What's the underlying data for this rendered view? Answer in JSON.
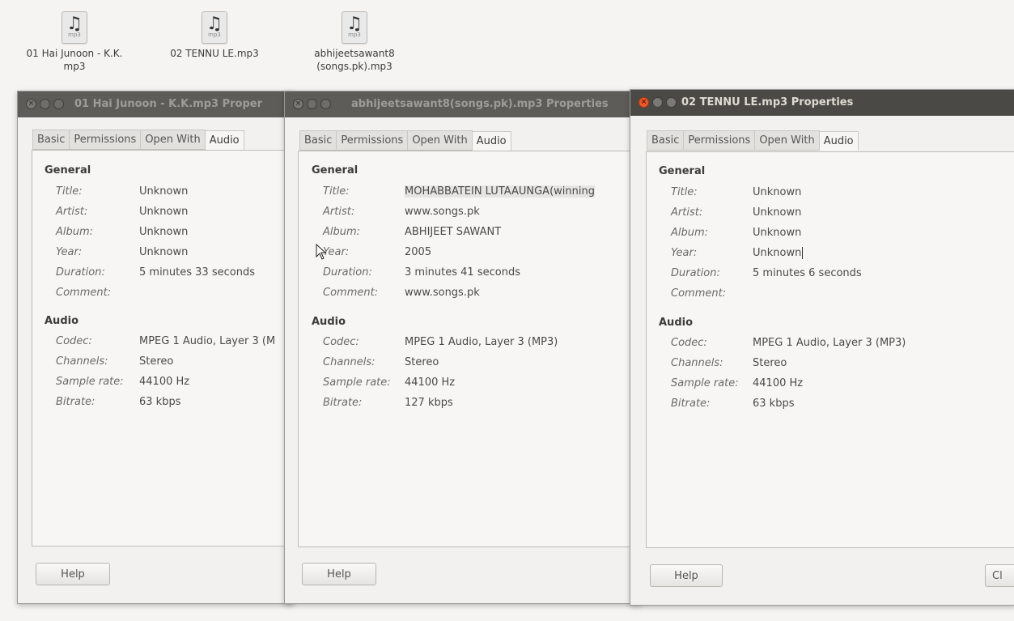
{
  "desktop": {
    "icons": [
      {
        "line1": "01 Hai Junoon - K.K.",
        "line2": "mp3",
        "ext": "mp3",
        "glyph": "music-note"
      },
      {
        "line1": "02 TENNU LE.mp3",
        "line2": "",
        "ext": "mp3",
        "glyph": "music-note"
      },
      {
        "line1": "abhijeetsawant8",
        "line2": "(songs.pk).mp3",
        "ext": "mp3",
        "glyph": "music-note"
      }
    ]
  },
  "tabs": [
    "Basic",
    "Permissions",
    "Open With",
    "Audio"
  ],
  "labels": {
    "general": "General",
    "audio": "Audio",
    "title": "Title:",
    "artist": "Artist:",
    "album": "Album:",
    "year": "Year:",
    "duration": "Duration:",
    "comment": "Comment:",
    "codec": "Codec:",
    "channels": "Channels:",
    "sample_rate": "Sample rate:",
    "bitrate": "Bitrate:",
    "help": "Help",
    "close_partial": "Cl"
  },
  "windows": [
    {
      "title": "01 Hai Junoon - K.K.mp3 Proper",
      "active": false,
      "values": {
        "title": "Unknown",
        "artist": "Unknown",
        "album": "Unknown",
        "year": "Unknown",
        "duration": "5 minutes 33 seconds",
        "comment": "",
        "codec": "MPEG 1 Audio, Layer 3 (M",
        "channels": "Stereo",
        "sample_rate": "44100 Hz",
        "bitrate": "63 kbps"
      }
    },
    {
      "title": "abhijeetsawant8(songs.pk).mp3 Properties",
      "active": false,
      "values": {
        "title": "MOHABBATEIN LUTAAUNGA(winning",
        "artist": "www.songs.pk",
        "album": "ABHIJEET SAWANT",
        "year": "2005",
        "duration": "3 minutes 41 seconds",
        "comment": "www.songs.pk",
        "codec": "MPEG 1 Audio, Layer 3 (MP3)",
        "channels": "Stereo",
        "sample_rate": "44100 Hz",
        "bitrate": "127 kbps"
      }
    },
    {
      "title": "02 TENNU LE.mp3 Properties",
      "active": true,
      "values": {
        "title": "Unknown",
        "artist": "Unknown",
        "album": "Unknown",
        "year": "Unknown",
        "duration": "5 minutes 6 seconds",
        "comment": "",
        "codec": "MPEG 1 Audio, Layer 3 (MP3)",
        "channels": "Stereo",
        "sample_rate": "44100 Hz",
        "bitrate": "63 kbps"
      }
    }
  ],
  "colors": {
    "titlebar_active": "#4a4945",
    "close_button": "#e9592c",
    "window_bg": "#f2f1f0"
  }
}
